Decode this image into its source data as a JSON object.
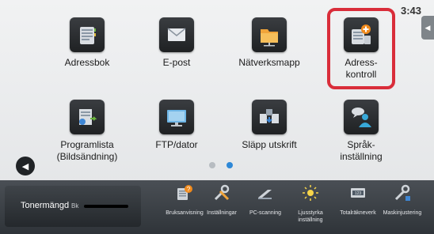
{
  "status": {
    "time": "3:43"
  },
  "tiles": [
    {
      "label": "Adressbok",
      "icon": "address-book-icon"
    },
    {
      "label": "E-post",
      "icon": "envelope-icon"
    },
    {
      "label": "Nätverksmapp",
      "icon": "folder-icon"
    },
    {
      "label": "Adress-kontroll",
      "line1": "Adress-",
      "line2": "kontroll",
      "icon": "address-control-icon"
    },
    {
      "label": "Programlista (Bildsändning)",
      "line1": "Programlista",
      "line2": "(Bildsändning)",
      "icon": "program-list-icon"
    },
    {
      "label": "FTP/dator",
      "icon": "monitor-icon"
    },
    {
      "label": "Släpp utskrift",
      "icon": "release-print-icon"
    },
    {
      "label": "Språk-inställning",
      "line1": "Språk-",
      "line2": "inställning",
      "icon": "language-person-icon"
    }
  ],
  "pager": {
    "pages": 2,
    "current": 2
  },
  "toner": {
    "label": "Tonermängd",
    "color_label": "Bk"
  },
  "bottom_buttons": [
    {
      "label": "Bruksanvisning",
      "icon": "manual-icon"
    },
    {
      "label": "Inställningar",
      "icon": "settings-tools-icon"
    },
    {
      "label": "PC-scanning",
      "icon": "scanner-icon"
    },
    {
      "label": "Ljusstyrka inställning",
      "line1": "Ljusstyrka",
      "line2": "inställning",
      "icon": "brightness-icon"
    },
    {
      "label": "Totalräkneverk",
      "icon": "counter-icon"
    },
    {
      "label": "Maskinjustering",
      "icon": "machine-adjust-icon"
    }
  ],
  "colors": {
    "highlight": "#d92d3a",
    "tile_bg": "#2b2e31",
    "accent_blue": "#2e88d7",
    "accent_orange": "#f08a1c",
    "bottom_bar": "#3a3f45"
  }
}
